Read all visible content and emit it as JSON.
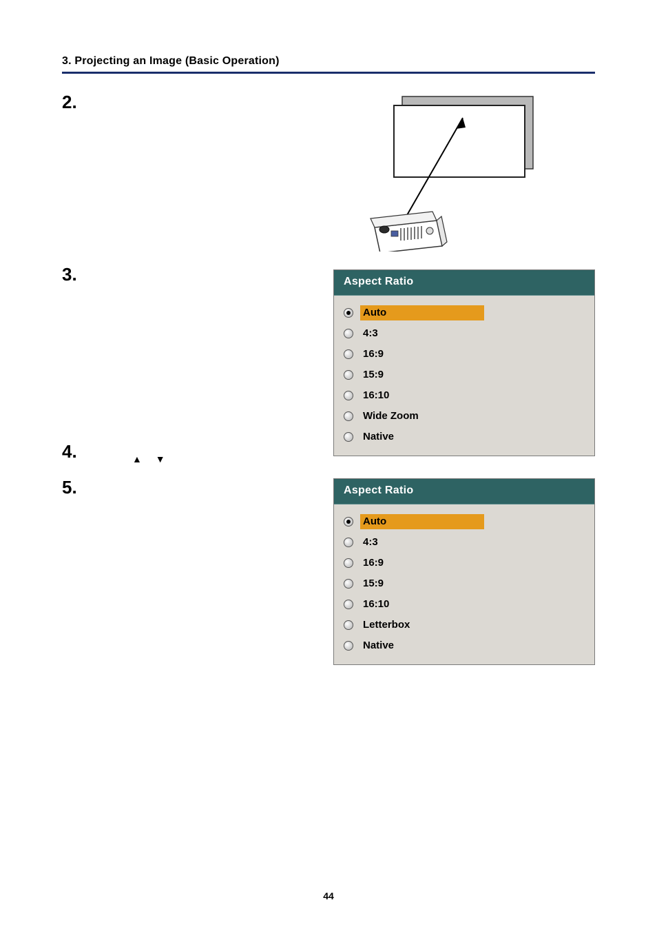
{
  "header": {
    "title": "3. Projecting an Image (Basic Operation)"
  },
  "steps": {
    "s2": "2.",
    "s3": "3.",
    "s4": "4.",
    "s4_arrows": "▲  ▼",
    "s5": "5."
  },
  "menu1": {
    "title": "Aspect Ratio",
    "items": [
      {
        "label": "Auto",
        "selected": true,
        "highlight": true
      },
      {
        "label": "4:3",
        "selected": false,
        "highlight": false
      },
      {
        "label": "16:9",
        "selected": false,
        "highlight": false
      },
      {
        "label": "15:9",
        "selected": false,
        "highlight": false
      },
      {
        "label": "16:10",
        "selected": false,
        "highlight": false
      },
      {
        "label": "Wide Zoom",
        "selected": false,
        "highlight": false
      },
      {
        "label": "Native",
        "selected": false,
        "highlight": false
      }
    ]
  },
  "menu2": {
    "title": "Aspect Ratio",
    "items": [
      {
        "label": "Auto",
        "selected": true,
        "highlight": true
      },
      {
        "label": "4:3",
        "selected": false,
        "highlight": false
      },
      {
        "label": "16:9",
        "selected": false,
        "highlight": false
      },
      {
        "label": "15:9",
        "selected": false,
        "highlight": false
      },
      {
        "label": "16:10",
        "selected": false,
        "highlight": false
      },
      {
        "label": "Letterbox",
        "selected": false,
        "highlight": false
      },
      {
        "label": "Native",
        "selected": false,
        "highlight": false
      }
    ]
  },
  "page_number": "44"
}
